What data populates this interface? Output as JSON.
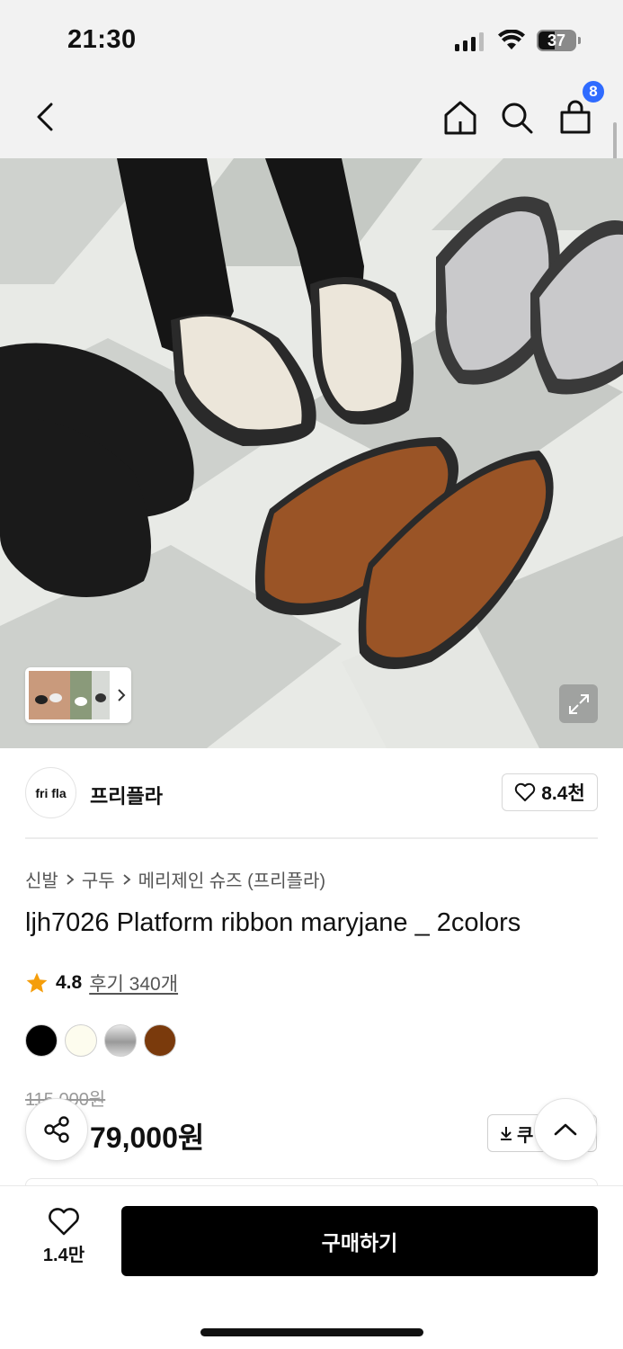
{
  "status_bar": {
    "time": "21:30",
    "battery": "37"
  },
  "header": {
    "cart_count": "8"
  },
  "gallery": {
    "colors": {
      "checker_light": "#e9ebe7",
      "checker_dark": "#c9ccc8",
      "black_shoe": "#1a1a1a",
      "cream_shoe": "#ece6da",
      "silver_shoe": "#c9c9cb",
      "brown_shoe": "#9a5426"
    }
  },
  "shop": {
    "logo_text": "fri fla",
    "name": "프리플라",
    "likes": "8.4천"
  },
  "breadcrumb": [
    "신발",
    "구두",
    "메리제인 슈즈 (프리플라)"
  ],
  "product": {
    "title": "ljh7026 Platform ribbon maryjane _ 2colors",
    "rating": "4.8",
    "review_link": "후기 340개",
    "swatches": [
      "#000000",
      "#fdfcee",
      "#b8b8b8",
      "#7a3a0c"
    ],
    "original_price": "115,000원",
    "sale_price": "79,000원",
    "coupon_label": "쿠"
  },
  "bottom_bar": {
    "wish_count": "1.4만",
    "buy_label": "구매하기"
  }
}
